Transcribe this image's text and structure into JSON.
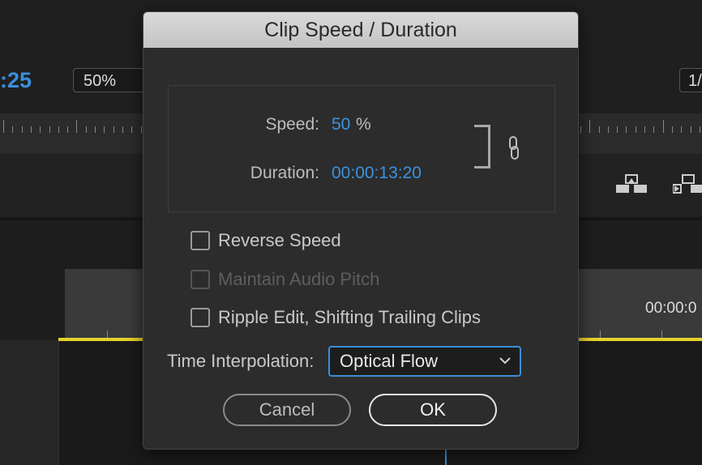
{
  "background": {
    "timecode": ":25",
    "zoom_value": "50%",
    "right_field": "1/",
    "track_timecode": "00:00:0"
  },
  "dialog": {
    "title": "Clip Speed / Duration",
    "speed_label": "Speed:",
    "speed_value": "50",
    "speed_unit": "%",
    "duration_label": "Duration:",
    "duration_value": "00:00:13:20",
    "link_icon": "chain-link-icon",
    "checkboxes": [
      {
        "label": "Reverse Speed",
        "checked": false,
        "enabled": true
      },
      {
        "label": "Maintain Audio Pitch",
        "checked": false,
        "enabled": false
      },
      {
        "label": "Ripple Edit, Shifting Trailing Clips",
        "checked": false,
        "enabled": true
      }
    ],
    "interpolation_label": "Time Interpolation:",
    "interpolation_value": "Optical Flow",
    "cancel_label": "Cancel",
    "ok_label": "OK"
  },
  "colors": {
    "accent_blue": "#3b92e0",
    "playhead_yellow": "#e6d22a",
    "dialog_bg": "#2c2c2c"
  }
}
